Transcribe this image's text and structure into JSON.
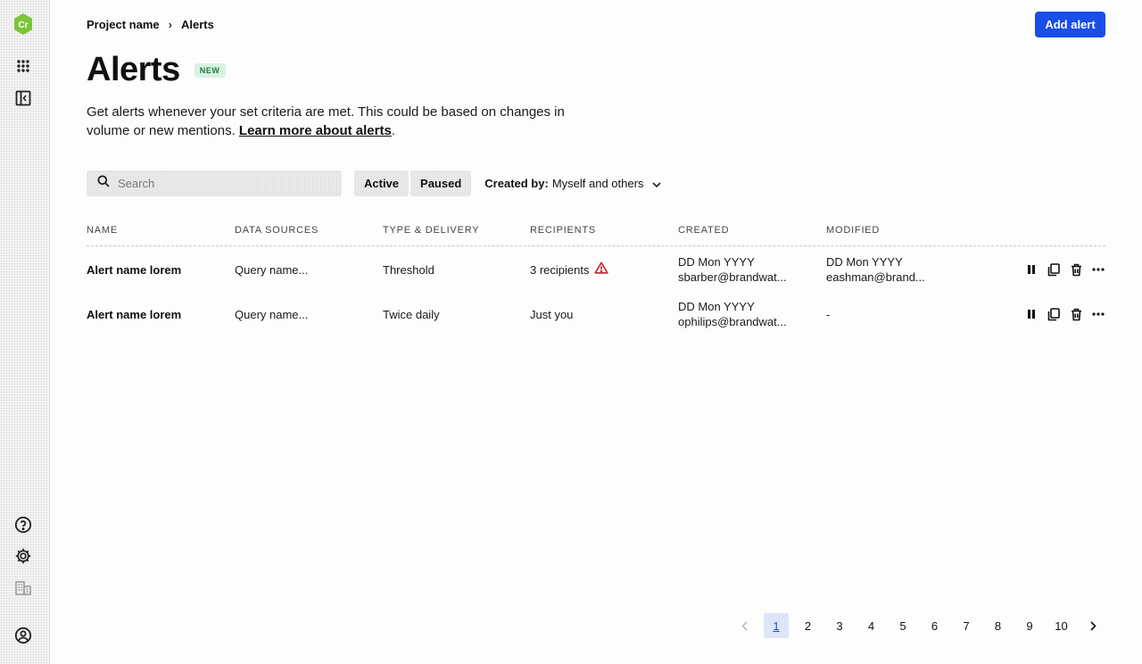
{
  "sidebar": {
    "logo_text": "Cr",
    "logo_color": "#7cc43a"
  },
  "breadcrumb": {
    "project": "Project name",
    "separator": "›",
    "current": "Alerts"
  },
  "header": {
    "add_button": "Add alert",
    "title": "Alerts",
    "badge": "NEW"
  },
  "description": {
    "text": "Get alerts whenever your set criteria are met. This could be based on changes in volume or new mentions.",
    "link": "Learn more about alerts",
    "trailing": "."
  },
  "filters": {
    "search_placeholder": "Search",
    "tabs": [
      "Active",
      "Paused"
    ],
    "created_by_label": "Created by:",
    "created_by_value": "Myself and others"
  },
  "table": {
    "columns": [
      "NAME",
      "DATA SOURCES",
      "TYPE & DELIVERY",
      "RECIPIENTS",
      "CREATED",
      "MODIFIED"
    ],
    "rows": [
      {
        "name": "Alert name lorem",
        "source": "Query name...",
        "type": "Threshold",
        "recipients": "3 recipients",
        "warning": true,
        "created_date": "DD Mon YYYY",
        "created_by": "sbarber@brandwat...",
        "modified_date": "DD Mon YYYY",
        "modified_by": "eashman@brand..."
      },
      {
        "name": "Alert name lorem",
        "source": "Query name...",
        "type": "Twice daily",
        "recipients": "Just you",
        "warning": false,
        "created_date": "DD Mon YYYY",
        "created_by": "ophilips@brandwat...",
        "modified_date": "-",
        "modified_by": ""
      }
    ]
  },
  "pagination": {
    "pages": [
      "1",
      "2",
      "3",
      "4",
      "5",
      "6",
      "7",
      "8",
      "9",
      "10"
    ],
    "current": "1"
  },
  "colors": {
    "primary": "#1a4ee8",
    "warning": "#c0262d",
    "badge_bg": "#d8f3e2"
  }
}
